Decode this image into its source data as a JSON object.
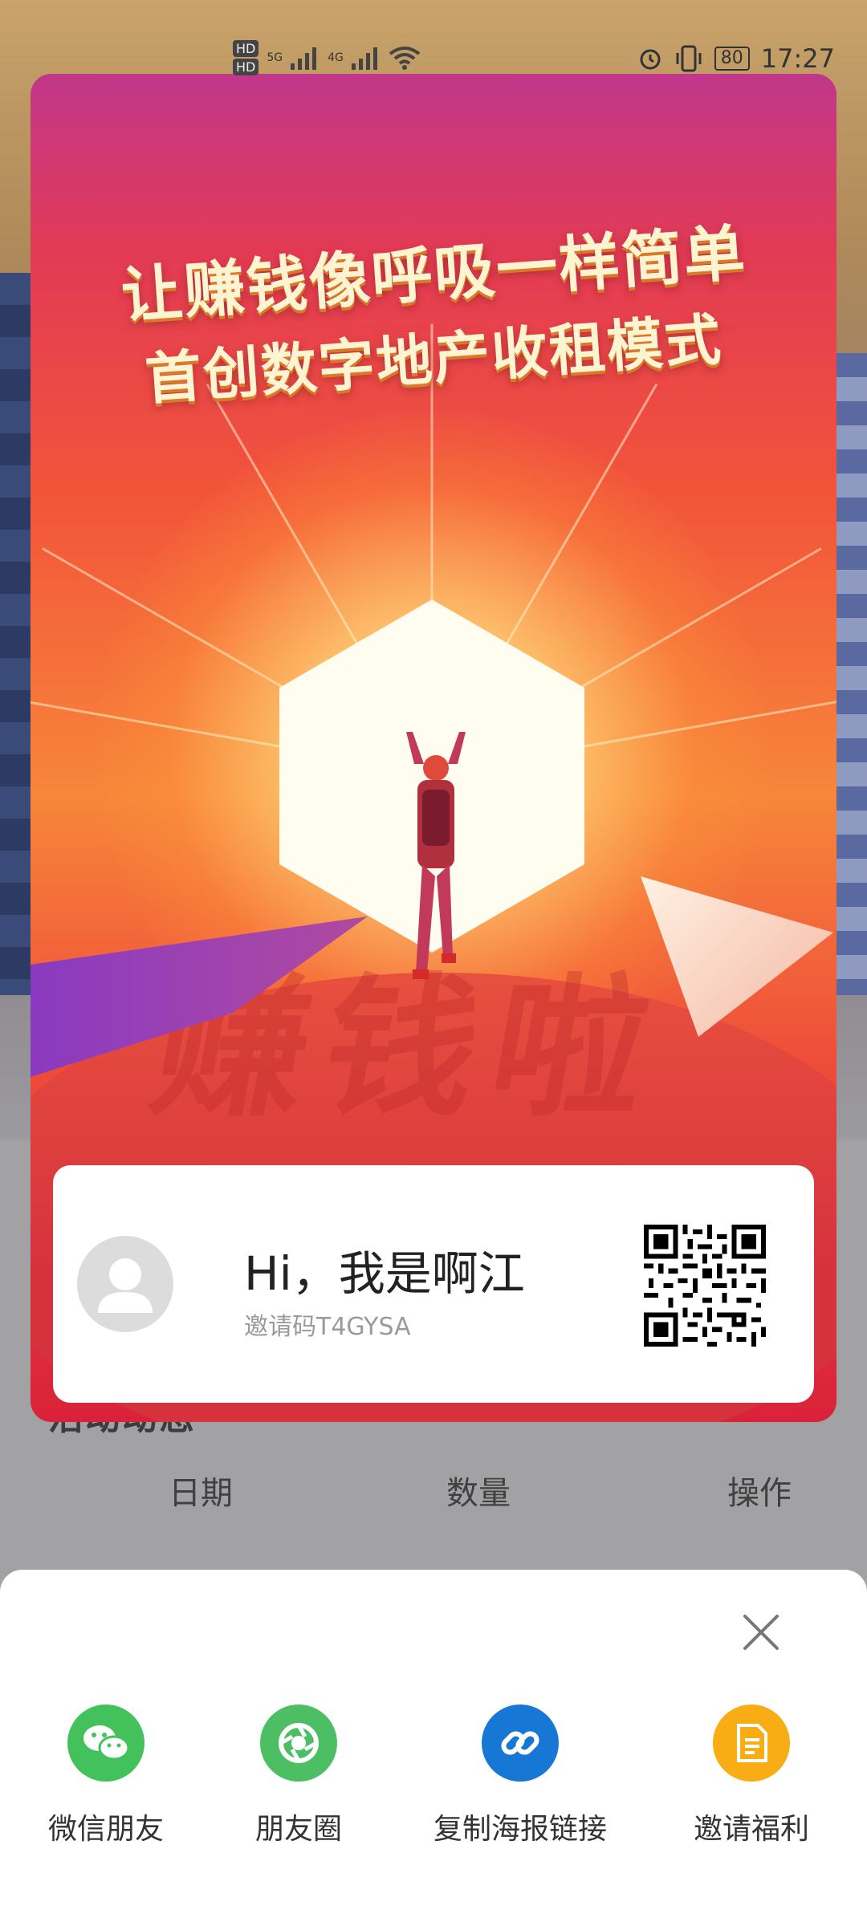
{
  "status_bar": {
    "hd1": "HD",
    "hd2": "HD",
    "net1": "5G",
    "net2": "4G",
    "battery": "80",
    "time": "17:27"
  },
  "poster": {
    "headline_1": "让赚钱像呼吸一样简单",
    "headline_2": "首创数字地产收租模式",
    "floor_text": "赚钱啦"
  },
  "invite_card": {
    "greeting": "Hi，我是啊江",
    "invite_code": "邀请码T4GYSA"
  },
  "background_page": {
    "section_title": "活动动态",
    "columns": [
      "日期",
      "数量",
      "操作"
    ]
  },
  "share_sheet": {
    "options": [
      {
        "label": "微信朋友",
        "icon": "wechat-icon",
        "color": "#43c25b"
      },
      {
        "label": "朋友圈",
        "icon": "moments-icon",
        "color": "#4cbf64"
      },
      {
        "label": "复制海报链接",
        "icon": "link-icon",
        "color": "#1677d4"
      },
      {
        "label": "邀请福利",
        "icon": "document-icon",
        "color": "#f7ad13"
      }
    ]
  }
}
